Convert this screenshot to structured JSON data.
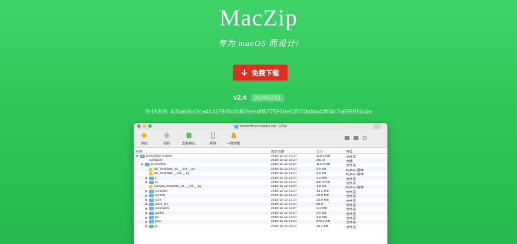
{
  "hero": {
    "title": "MacZip",
    "subtitle": "专为 macOS 而设计!",
    "download_label": "免费下载",
    "version": "v2.4",
    "release_date": "2024/02/01",
    "sha": "SHA256: 4d5ab6cc2ca41415930d3d82decdff677591de53574bdda42f04c7a659915cde"
  },
  "window": {
    "title": "tensorflow-master.zip - eZip",
    "toolbar": [
      {
        "label": "添加",
        "icon": "add-diamond-icon"
      },
      {
        "label": "提取",
        "icon": "extract-icon"
      },
      {
        "label": "全部解压",
        "icon": "extract-all-icon"
      },
      {
        "label": "移除",
        "icon": "remove-icon"
      },
      {
        "label": "一键清理",
        "icon": "cleanup-icon"
      }
    ],
    "columns": {
      "name": "名称",
      "modified": "修改日期",
      "size": "大小",
      "kind": "种类"
    },
    "rows": [
      {
        "name": "tensorflow-master",
        "level": 0,
        "type": "folder",
        "expand": "open",
        "modified": "2018-11-12 14:27",
        "size": "118.1 MB",
        "kind": "文件夹"
      },
      {
        "name": "configure",
        "level": 1,
        "type": "file",
        "expand": "none",
        "modified": "2018-11-12 14:27",
        "size": "281 B",
        "kind": "文稿"
      },
      {
        "name": "tensorflow",
        "level": 1,
        "type": "folder",
        "expand": "open",
        "modified": "2018-11-12 14:27",
        "size": "116.6 MB",
        "kind": "文件夹"
      },
      {
        "name": "api_template_v1.__init__.py",
        "level": 2,
        "type": "py",
        "expand": "none",
        "modified": "2018-11-12 14:27",
        "size": "2.9 KB",
        "kind": "Python 脚本"
      },
      {
        "name": "api_template.__init__.py",
        "level": 2,
        "type": "py",
        "expand": "none",
        "modified": "2018-11-12 14:27",
        "size": "2.5 KB",
        "kind": "Python 脚本"
      },
      {
        "name": "c",
        "level": 2,
        "type": "folder",
        "expand": "closed",
        "modified": "2018-11-12 14:27",
        "size": "1.2 MB",
        "kind": "文件夹"
      },
      {
        "name": "cc",
        "level": 2,
        "type": "folder",
        "expand": "closed",
        "modified": "2018-11-12 14:27",
        "size": "627.9 KB",
        "kind": "文件夹"
      },
      {
        "name": "compat_template_v1.__init__.py",
        "level": 2,
        "type": "py",
        "expand": "none",
        "modified": "2018-11-12 14:27",
        "size": "1.5 KB",
        "kind": "Python 脚本"
      },
      {
        "name": "compiler",
        "level": 2,
        "type": "folder",
        "expand": "closed",
        "modified": "2018-11-12 14:27",
        "size": "15.1 MB",
        "kind": "文件夹"
      },
      {
        "name": "contrib",
        "level": 2,
        "type": "folder",
        "expand": "closed",
        "modified": "2018-11-12 14:27",
        "size": "22.6 MB",
        "kind": "文件夹"
      },
      {
        "name": "core",
        "level": 2,
        "type": "folder",
        "expand": "closed",
        "modified": "2018-11-12 14:27",
        "size": "32.9 MB",
        "kind": "文件夹"
      },
      {
        "name": "docs_src",
        "level": 2,
        "type": "folder",
        "expand": "closed",
        "modified": "2018-11-12 14:27",
        "size": "85 B",
        "kind": "文件夹"
      },
      {
        "name": "examples",
        "level": 2,
        "type": "folder",
        "expand": "closed",
        "modified": "2018-11-12 14:27",
        "size": "3.1 MB",
        "kind": "文件夹"
      },
      {
        "name": "g3doc",
        "level": 2,
        "type": "folder",
        "expand": "closed",
        "modified": "2018-11-12 14:27",
        "size": "2.0 KB",
        "kind": "文件夹"
      },
      {
        "name": "go",
        "level": 2,
        "type": "folder",
        "expand": "closed",
        "modified": "2018-11-12 14:27",
        "size": "1.9 MB",
        "kind": "文件夹"
      },
      {
        "name": "java",
        "level": 2,
        "type": "folder",
        "expand": "closed",
        "modified": "2018-11-12 14:27",
        "size": "576.2 KB",
        "kind": "文件夹"
      },
      {
        "name": "js",
        "level": 2,
        "type": "folder",
        "expand": "closed",
        "modified": "2018-11-12 14:27",
        "size": "15.7 KB",
        "kind": "文件夹"
      }
    ]
  }
}
